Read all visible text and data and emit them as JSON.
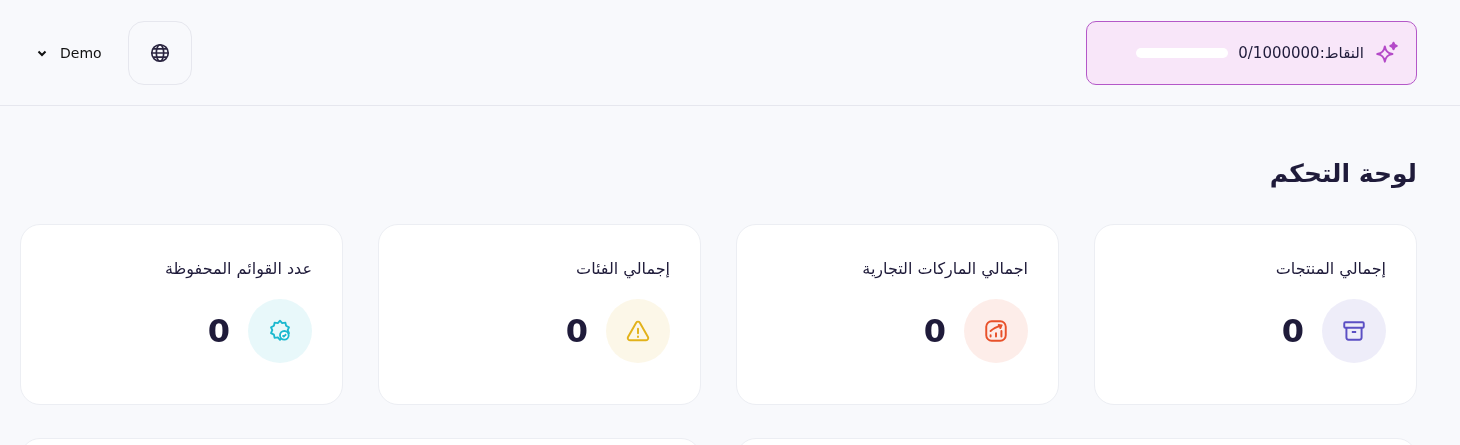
{
  "header": {
    "points": {
      "label": "النقاط:",
      "value": "0/1000000",
      "level": 0
    },
    "user": {
      "name": "Demo"
    }
  },
  "page": {
    "title": "لوحة التحكم"
  },
  "stats": [
    {
      "title": "إجمالي المنتجات",
      "value": "0",
      "kind": "box",
      "color": "#5b4fc4"
    },
    {
      "title": "اجمالي الماركات التجارية",
      "value": "0",
      "kind": "chart",
      "color": "#e8512a"
    },
    {
      "title": "إجمالي الفئات",
      "value": "0",
      "kind": "warning",
      "color": "#e2b21a"
    },
    {
      "title": "عدد القوائم المحفوظة",
      "value": "0",
      "kind": "gear",
      "color": "#1bb8cf"
    }
  ]
}
